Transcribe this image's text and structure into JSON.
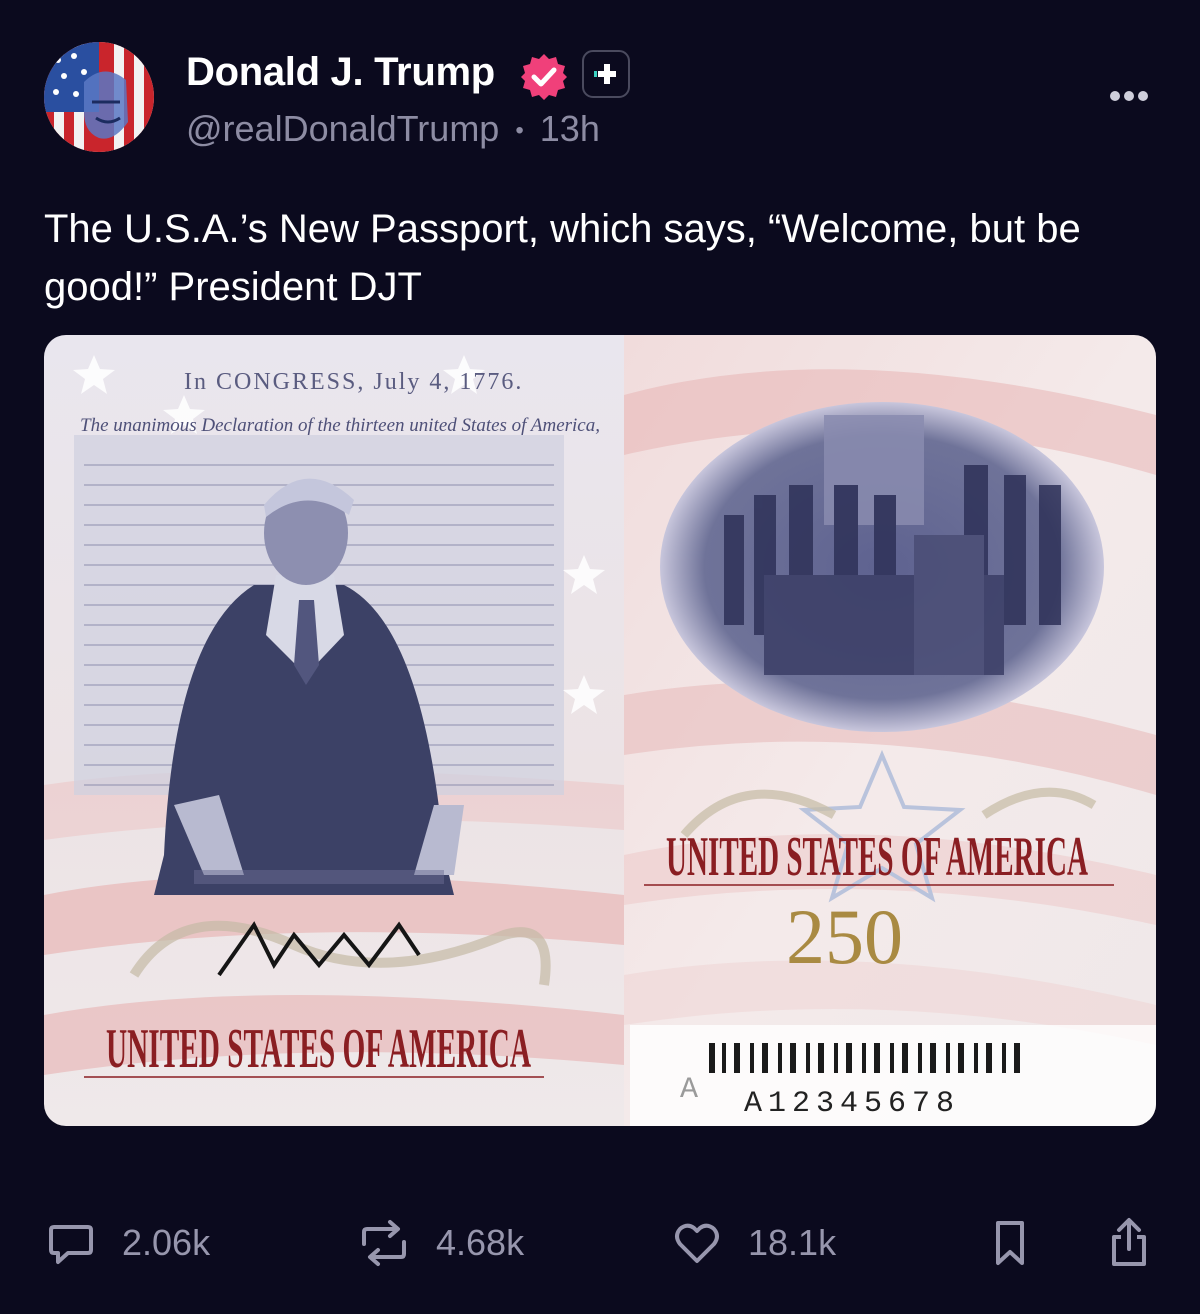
{
  "author": {
    "name": "Donald J. Trump",
    "handle": "@realDonaldTrump",
    "time": "13h",
    "separator": "•",
    "verified_icon": "verified-badge-icon",
    "badge_icon": "plus-badge-icon"
  },
  "post": {
    "text": "The U.S.A.’s New Passport, which says, “Welcome, but be good!” President DJT"
  },
  "media": {
    "doc_header": "In CONGRESS, July 4, 1776.",
    "doc_title": "The unanimous Declaration of the thirteen united States of America,",
    "banner_left": "UNITED STATES OF AMERICA",
    "banner_right": "UNITED STATES OF AMERICA",
    "anniversary": "250",
    "serial_prefix": "A",
    "serial": "A12345678"
  },
  "actions": {
    "replies": "2.06k",
    "reposts": "4.68k",
    "likes": "18.1k"
  },
  "colors": {
    "background": "#0b0a1e",
    "secondary_text": "#8d8ca3",
    "verified": "#f0407a",
    "banner_red": "#8a1e22"
  }
}
